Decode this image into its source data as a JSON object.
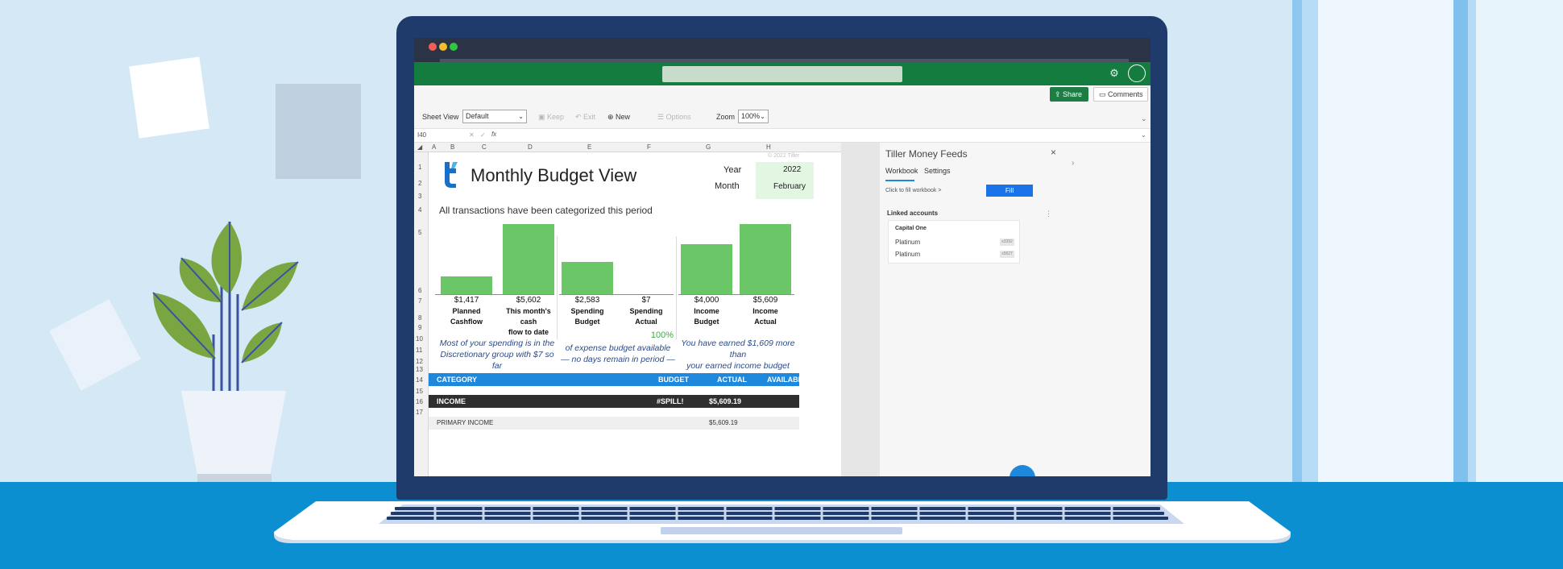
{
  "app": {
    "sheet_view_label": "Sheet View",
    "sheet_view_value": "Default",
    "keep_label": "Keep",
    "exit_label": "Exit",
    "new_label": "New",
    "options_label": "Options",
    "zoom_label": "Zoom",
    "zoom_value": "100%",
    "share_label": "Share",
    "comments_label": "Comments",
    "cell_ref": "I40",
    "fx": "fx"
  },
  "grid": {
    "columns": [
      "A",
      "B",
      "C",
      "D",
      "E",
      "F",
      "G",
      "H"
    ],
    "rows": [
      "1",
      "2",
      "3",
      "4",
      "5",
      "6",
      "7",
      "8",
      "9",
      "10",
      "11",
      "12",
      "13",
      "14",
      "15",
      "16",
      "17"
    ]
  },
  "sheet": {
    "title": "Monthly Budget View",
    "copyright": "© 2022 Tiller",
    "year_label": "Year",
    "year_value": "2022",
    "month_label": "Month",
    "month_value": "February",
    "subtitle": "All transactions have been categorized this period",
    "pct_available": "100%",
    "note_left_1": "Most of your spending is in the",
    "note_left_2": "Discretionary group with $7 so far",
    "note_mid_1": "of expense budget available",
    "note_mid_2": "— no days remain in period —",
    "note_right_1": "You have earned $1,609 more than",
    "note_right_2": "your earned income budget"
  },
  "chart_data": {
    "type": "bar",
    "categories": [
      "Planned Cashflow",
      "This month's cash flow to date",
      "Spending Budget",
      "Spending Actual",
      "Income Budget",
      "Income Actual"
    ],
    "values": [
      1417,
      5602,
      2583,
      7,
      4000,
      5609
    ],
    "value_labels": [
      "$1,417",
      "$5,602",
      "$2,583",
      "$7",
      "$4,000",
      "$5,609"
    ],
    "label_lines": [
      [
        "Planned",
        "Cashflow"
      ],
      [
        "This month's cash",
        "flow to date"
      ],
      [
        "Spending",
        "Budget"
      ],
      [
        "Spending",
        "Actual"
      ],
      [
        "Income",
        "Budget"
      ],
      [
        "Income",
        "Actual"
      ]
    ],
    "groups": [
      [
        0,
        1
      ],
      [
        2,
        3
      ],
      [
        4,
        5
      ]
    ],
    "color": "#6bc667"
  },
  "table": {
    "headers": [
      "CATEGORY",
      "BUDGET",
      "ACTUAL",
      "AVAILABLE"
    ],
    "income_row": {
      "label": "INCOME",
      "budget": "#SPILL!",
      "actual": "$5,609.19"
    },
    "next_row": {
      "label": "PRIMARY INCOME",
      "actual": "$5,609.19"
    }
  },
  "panel": {
    "title": "Tiller Money Feeds",
    "tab_workbook": "Workbook",
    "tab_settings": "Settings",
    "hint": "Click to fill workbook >",
    "fill_label": "Fill",
    "linked_label": "Linked accounts",
    "bank": "Capital One",
    "accounts": [
      {
        "name": "Platinum",
        "mask": "x3392"
      },
      {
        "name": "Platinum",
        "mask": "x5627"
      }
    ]
  },
  "colors": {
    "excel_green": "#157c3f",
    "header_blue": "#1e88dc",
    "floor": "#0b8fd0",
    "laptop": "#1f3b6b"
  }
}
